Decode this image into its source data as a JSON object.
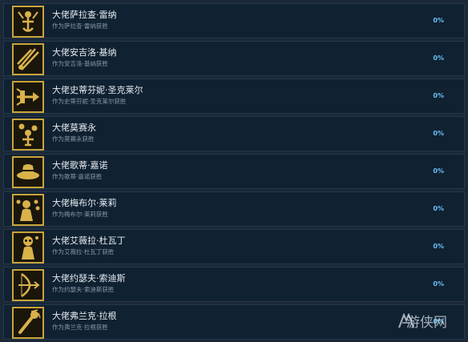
{
  "achievements": [
    {
      "title": "大佬萨拉查·雷纳",
      "desc": "作为萨拉查·雷纳获胜",
      "percent": "0%",
      "icon": "anchor-figure-icon"
    },
    {
      "title": "大佬安吉洛·基纳",
      "desc": "作为安吉洛·基纳获胜",
      "percent": "0%",
      "icon": "crossed-blades-icon"
    },
    {
      "title": "大佬史蒂芬妮·圣克莱尔",
      "desc": "作为史蒂芬妮·圣克莱尔获胜",
      "percent": "0%",
      "icon": "dagger-hand-icon"
    },
    {
      "title": "大佬莫赛永",
      "desc": "作为莫赛永获胜",
      "percent": "0%",
      "icon": "juggler-icon"
    },
    {
      "title": "大佬歌蒂·嘉诺",
      "desc": "作为歌蒂·嘉诺获胜",
      "percent": "0%",
      "icon": "hat-icon"
    },
    {
      "title": "大佬梅布尔·莱莉",
      "desc": "作为梅布尔·莱莉获胜",
      "percent": "0%",
      "icon": "lady-coins-icon"
    },
    {
      "title": "大佬艾薇拉·杜瓦丁",
      "desc": "作为艾薇拉·杜瓦丁获胜",
      "percent": "0%",
      "icon": "skull-lady-icon"
    },
    {
      "title": "大佬约瑟夫·索迪斯",
      "desc": "作为约瑟夫·索迪斯获胜",
      "percent": "0%",
      "icon": "archer-icon"
    },
    {
      "title": "大佬弗兰克·拉根",
      "desc": "作为弗兰克·拉根获胜",
      "percent": "0%",
      "icon": "club-icon"
    }
  ],
  "watermark": {
    "text": "游侠网",
    "icon": "ranger-logo-icon"
  },
  "colors": {
    "background": "#1b2838",
    "row": "#102131",
    "icon_border": "#c9a43a",
    "percent": "#66c0f4"
  }
}
